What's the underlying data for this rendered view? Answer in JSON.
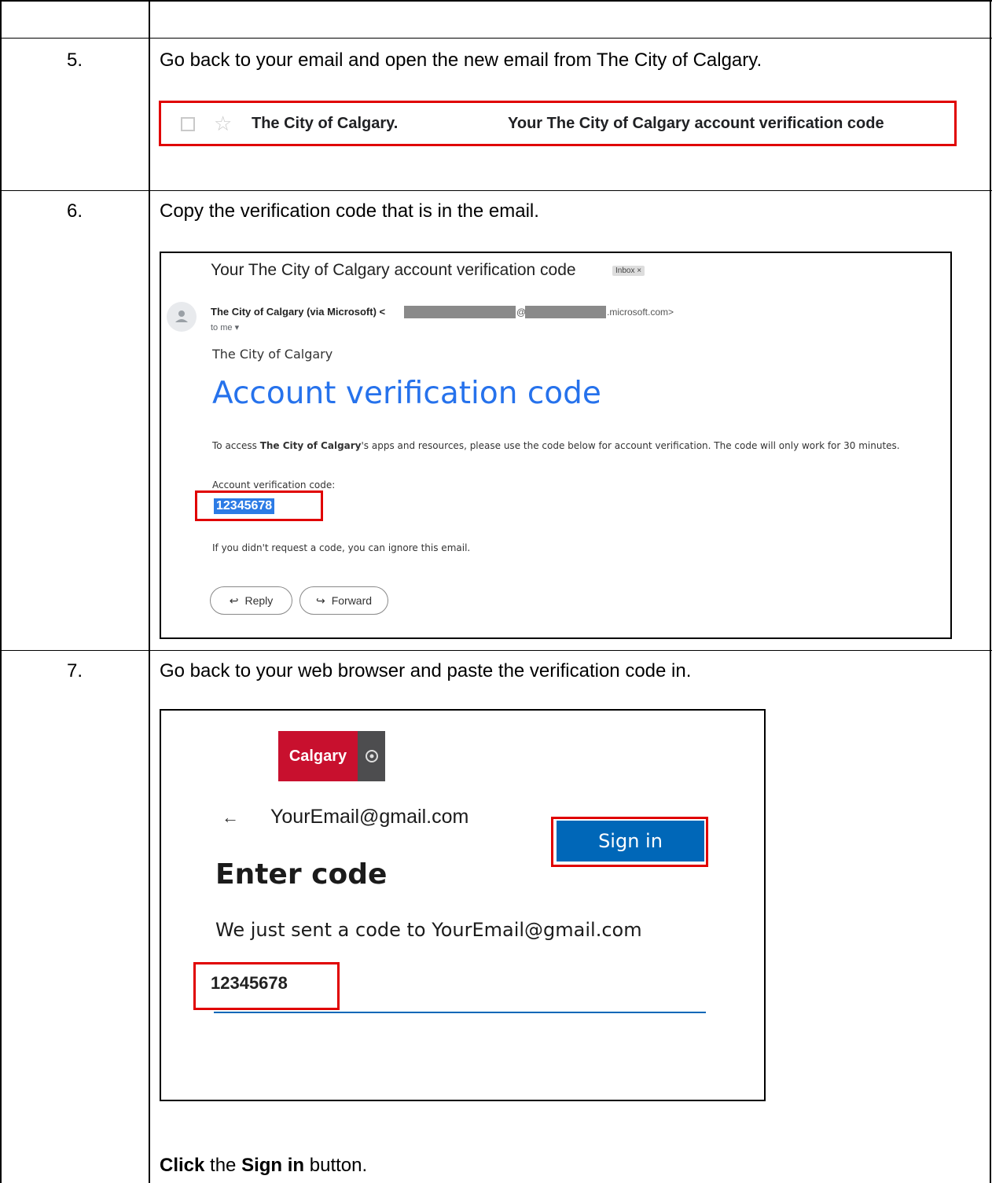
{
  "steps": [
    {
      "number": "5.",
      "instruction": "Go back to your email and open the new email from The City of Calgary.",
      "inbox_row": {
        "sender": "The City of Calgary.",
        "subject": "Your The City of Calgary account verification code"
      }
    },
    {
      "number": "6.",
      "instruction": "Copy the verification code that is in the email.",
      "email": {
        "subject": "Your The City of Calgary account verification code",
        "inbox_badge": "Inbox ×",
        "from_name": "The City of Calgary (via Microsoft) <",
        "from_at": "@",
        "from_domain": ".microsoft.com>",
        "to_line": "to me ▾",
        "org_name": "The City of Calgary",
        "title": "Account verification code",
        "body_prefix": "To access ",
        "body_org": "The City of Calgary",
        "body_suffix": "'s apps and resources, please use the code below for account verification. The code will only work for 30 minutes.",
        "code_label": "Account verification code:",
        "code": "12345678",
        "ignore_note": "If you didn't request a code, you can ignore this email.",
        "reply_label": "Reply",
        "forward_label": "Forward"
      }
    },
    {
      "number": "7.",
      "instruction": "Go back to your web browser and paste the verification code in.",
      "signin": {
        "logo_text": "Calgary",
        "email": "YourEmail@gmail.com",
        "heading": "Enter code",
        "description": "We just sent a code to YourEmail@gmail.com",
        "code_value": "12345678",
        "button_label": "Sign in"
      },
      "footer": {
        "click": "Click",
        "the": " the ",
        "signin": "Sign in",
        "button": " button."
      }
    }
  ],
  "colors": {
    "highlight_red": "#e00000",
    "link_blue": "#2672ec",
    "ms_blue": "#0067b8",
    "calgary_red": "#c8102e"
  },
  "icons": [
    "checkbox-icon",
    "star-icon",
    "avatar-icon",
    "reply-icon",
    "forward-icon",
    "back-arrow-icon",
    "calgary-crest-icon"
  ]
}
